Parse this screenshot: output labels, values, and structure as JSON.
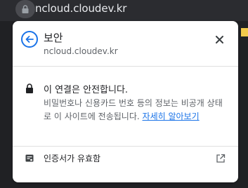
{
  "browser": {
    "url": "ncloud.cloudev.kr"
  },
  "popup": {
    "title": "보안",
    "subtitle": "ncloud.cloudev.kr",
    "back_icon": "arrow-left-icon",
    "close_icon": "close-icon",
    "connection": {
      "icon": "lock-icon",
      "title": "이 연결은 안전합니다.",
      "description": "비밀번호나 신용카드 번호 등의 정보는 비공개 상태로 이 사이트에 전송됩니다.",
      "link": "자세히 알아보기"
    },
    "certificate": {
      "icon": "certificate-icon",
      "label": "인증서가 유효함",
      "external_icon": "external-link-icon"
    }
  },
  "colors": {
    "accent": "#1a73e8",
    "text_primary": "#202124",
    "text_secondary": "#5f6368",
    "chrome_dark": "#202124"
  }
}
